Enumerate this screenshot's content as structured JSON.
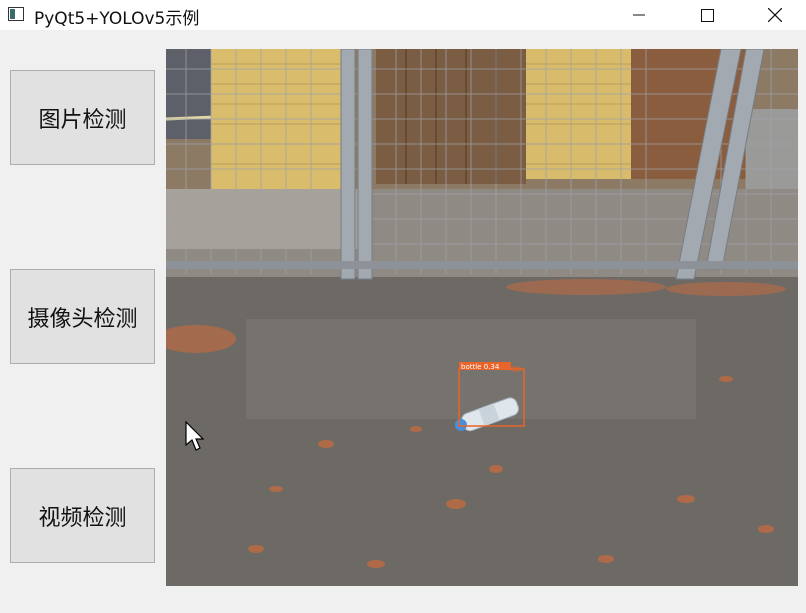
{
  "window": {
    "title": "PyQt5+YOLOv5示例",
    "controls": [
      "minimize",
      "maximize",
      "close"
    ]
  },
  "sidebar": {
    "buttons": [
      {
        "label": "图片检测"
      },
      {
        "label": "摄像头检测"
      },
      {
        "label": "视频检测"
      }
    ]
  },
  "viewer": {
    "detection": {
      "label": "bottle 0.34",
      "box_color": "#e8642a"
    }
  },
  "colors": {
    "titlebar_bg": "#ffffff",
    "window_bg": "#f0f0f0",
    "button_bg": "#e1e1e1",
    "button_border": "#adadad"
  }
}
